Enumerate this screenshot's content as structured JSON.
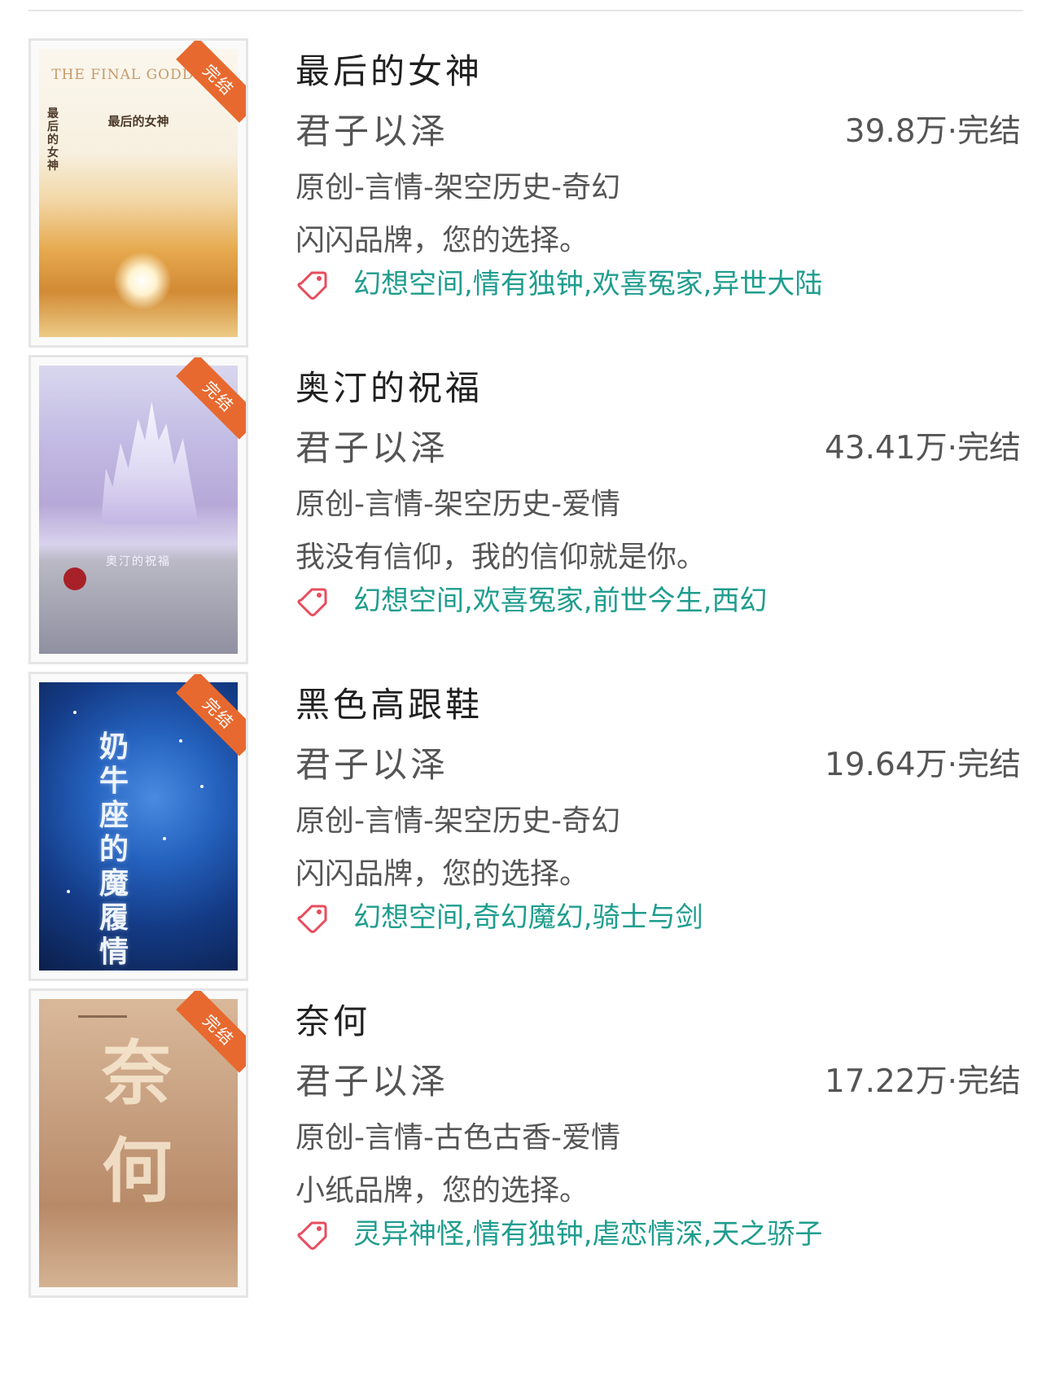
{
  "books": [
    {
      "title": "最后的女神",
      "author": "君子以泽",
      "stats": "39.8万·完结",
      "category": "原创-言情-架空历史-奇幻",
      "intro": "闪闪品牌，您的选择。",
      "tags": "幻想空间,情有独钟,欢喜冤家,异世大陆",
      "badge": "完结",
      "cover": {
        "title_en": "THE FINAL GODDESS",
        "title_cn": "最后的女神",
        "spine_text": "最后的女神"
      }
    },
    {
      "title": "奥汀的祝福",
      "author": "君子以泽",
      "stats": "43.41万·完结",
      "category": "原创-言情-架空历史-爱情",
      "intro": "我没有信仰，我的信仰就是你。",
      "tags": "幻想空间,欢喜冤家,前世今生,西幻",
      "badge": "完结",
      "cover": {
        "title_cn": "奥汀的祝福"
      }
    },
    {
      "title": "黑色高跟鞋",
      "author": "君子以泽",
      "stats": "19.64万·完结",
      "category": "原创-言情-架空历史-奇幻",
      "intro": "闪闪品牌，您的选择。",
      "tags": "幻想空间,奇幻魔幻,骑士与剑",
      "badge": "完结",
      "cover": {
        "title_cn": "奶牛座的魔履情缘"
      }
    },
    {
      "title": "奈何",
      "author": "君子以泽",
      "stats": "17.22万·完结",
      "category": "原创-言情-古色古香-爱情",
      "intro": "小纸品牌，您的选择。",
      "tags": "灵异神怪,情有独钟,虐恋情深,天之骄子",
      "badge": "完结",
      "cover": {
        "title_cn": "奈何"
      }
    }
  ],
  "icons": {
    "tag": "tag-icon"
  },
  "colors": {
    "tag_text": "#1f9d8e",
    "badge": "#e7692f",
    "tag_icon": "#e84c5d"
  }
}
